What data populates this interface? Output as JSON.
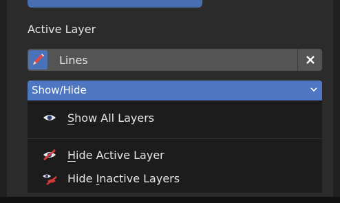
{
  "section": {
    "label": "Active Layer"
  },
  "layer": {
    "name": "Lines",
    "close_glyph": "✕"
  },
  "dropdown": {
    "label": "Show/Hide",
    "chevron": "⌄"
  },
  "menu": {
    "items": [
      {
        "first": "S",
        "rest": "how All Layers"
      },
      {
        "first": "H",
        "rest": "ide Active Layer"
      },
      {
        "pre": "Hide ",
        "u": "I",
        "post": "nactive Layers"
      }
    ]
  },
  "colors": {
    "accent": "#4f77c1",
    "panel": "#2b2b2b",
    "menu_bg": "#1c1c1c"
  }
}
